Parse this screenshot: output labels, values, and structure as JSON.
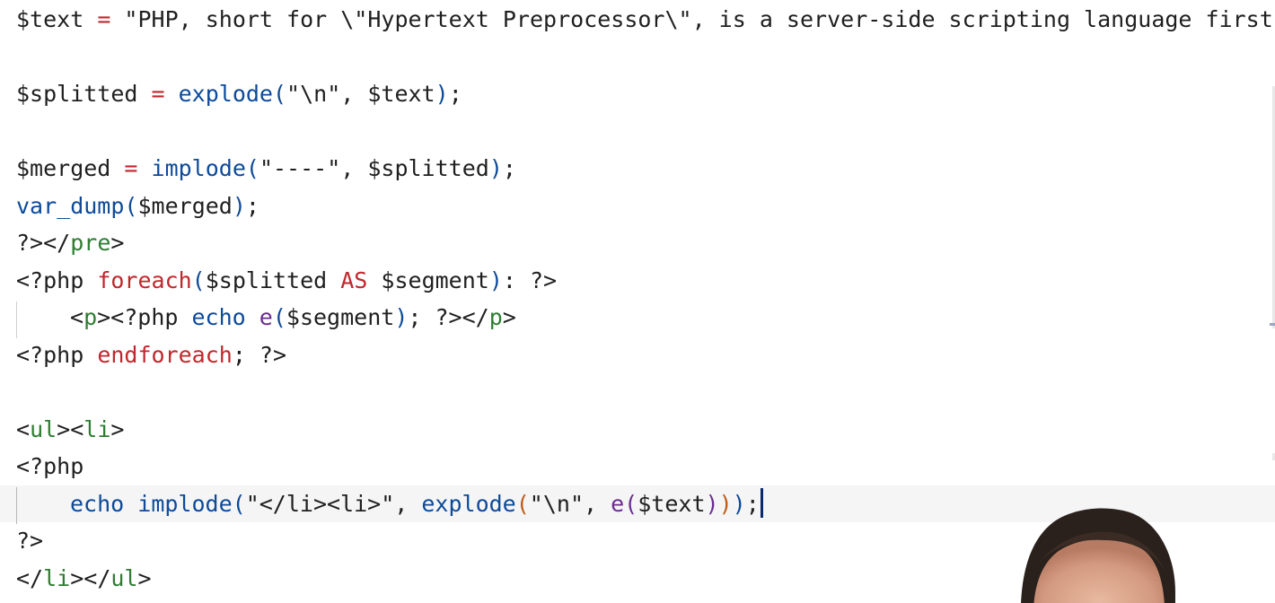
{
  "editor": {
    "lines": [
      {
        "tokens": [
          {
            "t": "$text",
            "c": "t-var"
          },
          {
            "t": " = ",
            "c": "t-op"
          },
          {
            "t": "\"PHP, short for \\\"Hypertext Preprocessor\\\", is a server-side scripting language first",
            "c": "t-str"
          }
        ]
      },
      {
        "tokens": []
      },
      {
        "tokens": [
          {
            "t": "$splitted",
            "c": "t-var"
          },
          {
            "t": " = ",
            "c": "t-op"
          },
          {
            "t": "explode",
            "c": "t-fn"
          },
          {
            "t": "(",
            "c": "t-paren"
          },
          {
            "t": "\"\\n\", $text",
            "c": "t-str"
          },
          {
            "t": ")",
            "c": "t-paren"
          },
          {
            "t": ";",
            "c": "t-punct"
          }
        ]
      },
      {
        "tokens": []
      },
      {
        "tokens": [
          {
            "t": "$merged",
            "c": "t-var"
          },
          {
            "t": " = ",
            "c": "t-op"
          },
          {
            "t": "implode",
            "c": "t-fn"
          },
          {
            "t": "(",
            "c": "t-paren"
          },
          {
            "t": "\"----\", $splitted",
            "c": "t-str"
          },
          {
            "t": ")",
            "c": "t-paren"
          },
          {
            "t": ";",
            "c": "t-punct"
          }
        ]
      },
      {
        "tokens": [
          {
            "t": "var_dump",
            "c": "t-fn"
          },
          {
            "t": "(",
            "c": "t-paren"
          },
          {
            "t": "$merged",
            "c": "t-var"
          },
          {
            "t": ")",
            "c": "t-paren"
          },
          {
            "t": ";",
            "c": "t-punct"
          }
        ]
      },
      {
        "tokens": [
          {
            "t": "?></",
            "c": "t-php"
          },
          {
            "t": "pre",
            "c": "t-tag"
          },
          {
            "t": ">",
            "c": "t-php"
          }
        ]
      },
      {
        "tokens": [
          {
            "t": "<?php ",
            "c": "t-php"
          },
          {
            "t": "foreach",
            "c": "t-kw"
          },
          {
            "t": "(",
            "c": "t-paren"
          },
          {
            "t": "$splitted ",
            "c": "t-var"
          },
          {
            "t": "AS",
            "c": "t-kw"
          },
          {
            "t": " $segment",
            "c": "t-var"
          },
          {
            "t": ")",
            "c": "t-paren"
          },
          {
            "t": ": ?>",
            "c": "t-php"
          }
        ]
      },
      {
        "indented": true,
        "tokens": [
          {
            "t": "<",
            "c": "t-php"
          },
          {
            "t": "p",
            "c": "t-tag"
          },
          {
            "t": "><?php ",
            "c": "t-php"
          },
          {
            "t": "echo",
            "c": "t-echo"
          },
          {
            "t": " ",
            "c": "t-php"
          },
          {
            "t": "e",
            "c": "t-e"
          },
          {
            "t": "(",
            "c": "t-paren"
          },
          {
            "t": "$segment",
            "c": "t-var"
          },
          {
            "t": ")",
            "c": "t-paren"
          },
          {
            "t": "; ?></",
            "c": "t-php"
          },
          {
            "t": "p",
            "c": "t-tag"
          },
          {
            "t": ">",
            "c": "t-php"
          }
        ]
      },
      {
        "tokens": [
          {
            "t": "<?php ",
            "c": "t-php"
          },
          {
            "t": "endforeach",
            "c": "t-kw"
          },
          {
            "t": "; ?>",
            "c": "t-php"
          }
        ]
      },
      {
        "tokens": []
      },
      {
        "tokens": [
          {
            "t": "<",
            "c": "t-php"
          },
          {
            "t": "ul",
            "c": "t-tag"
          },
          {
            "t": "><",
            "c": "t-php"
          },
          {
            "t": "li",
            "c": "t-tag"
          },
          {
            "t": ">",
            "c": "t-php"
          }
        ]
      },
      {
        "tokens": [
          {
            "t": "<?php",
            "c": "t-php"
          }
        ]
      },
      {
        "indented": true,
        "current": true,
        "cursor": true,
        "tokens": [
          {
            "t": "echo",
            "c": "t-echo"
          },
          {
            "t": " ",
            "c": "t-php"
          },
          {
            "t": "implode",
            "c": "t-fn"
          },
          {
            "t": "(",
            "c": "t-paren"
          },
          {
            "t": "\"</li><li>\", ",
            "c": "t-str"
          },
          {
            "t": "explode",
            "c": "t-fn"
          },
          {
            "t": "(",
            "c": "t-paren2"
          },
          {
            "t": "\"\\n\", ",
            "c": "t-str"
          },
          {
            "t": "e",
            "c": "t-e"
          },
          {
            "t": "(",
            "c": "t-e"
          },
          {
            "t": "$text",
            "c": "t-var"
          },
          {
            "t": ")",
            "c": "t-e"
          },
          {
            "t": ")",
            "c": "t-paren2"
          },
          {
            "t": ")",
            "c": "t-paren"
          },
          {
            "t": ";",
            "c": "t-punct"
          }
        ]
      },
      {
        "tokens": [
          {
            "t": "?>",
            "c": "t-php"
          }
        ]
      },
      {
        "tokens": [
          {
            "t": "</",
            "c": "t-php"
          },
          {
            "t": "li",
            "c": "t-tag"
          },
          {
            "t": "></",
            "c": "t-php"
          },
          {
            "t": "ul",
            "c": "t-tag"
          },
          {
            "t": ">",
            "c": "t-php"
          }
        ]
      }
    ]
  },
  "colors": {
    "keyword": "#c0272d",
    "function": "#0d4a99",
    "tag": "#2e7d32",
    "e_function": "#6a2c91",
    "nested_paren": "#c05a16",
    "current_line_bg": "#f5f5f5",
    "cursor": "#0b2a6b"
  },
  "overlay": {
    "icon": "presenter-avatar"
  }
}
